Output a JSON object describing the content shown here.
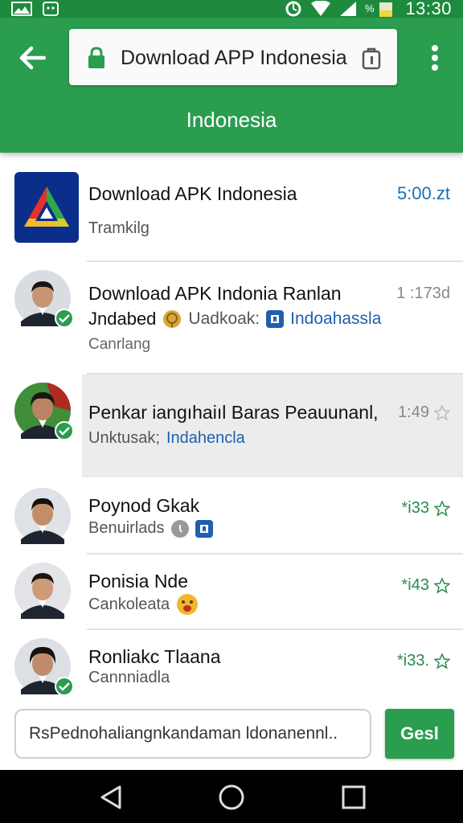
{
  "status_bar": {
    "time": "13:30"
  },
  "browser": {
    "url": "Download APP Indonesia",
    "page_title": "Indonesia"
  },
  "list": [
    {
      "name": "Download APK Indonesia",
      "subtitle": "Tramkilg",
      "time": "5:00.zt"
    },
    {
      "name": "Download APK Indonia Ranlan",
      "line2_a": "Jndabed",
      "line2_b": "Uadkoak:",
      "line2_link": "Indoahassla",
      "status": "Canrlang",
      "time": "1 :173d",
      "verified": true
    },
    {
      "name": "Penkar iangıhaiıl Baras Peauunanl,",
      "sub_a": "Unktusak;",
      "sub_link": "Indahencla",
      "time": "1:49",
      "verified": true,
      "highlighted": true
    },
    {
      "name": "Poynod Gkak",
      "subtitle": "Benuirlads",
      "time": "*i33"
    },
    {
      "name": "Ponisia Nde",
      "subtitle": "Cankoleata",
      "time": "*i43"
    },
    {
      "name": "Ronliakc Tlaana",
      "subtitle": "Cannniadla",
      "time": "*i33.",
      "verified": true
    }
  ],
  "compose": {
    "placeholder": "RsPednohaliangnkandaman ldonanennl..",
    "send_label": "Gesl"
  },
  "colors": {
    "primary": "#2a9d4f",
    "status_bar": "#1e8a3e",
    "link": "#1f5fae",
    "time_blue": "#1a6fb5"
  },
  "icons": [
    "signal-icon",
    "wifi-icon",
    "battery-icon",
    "back-arrow-icon",
    "lock-icon",
    "tabs-icon",
    "overflow-menu-icon",
    "verified-icon",
    "star-icon",
    "nav-back-icon",
    "nav-home-icon",
    "nav-recents-icon"
  ]
}
